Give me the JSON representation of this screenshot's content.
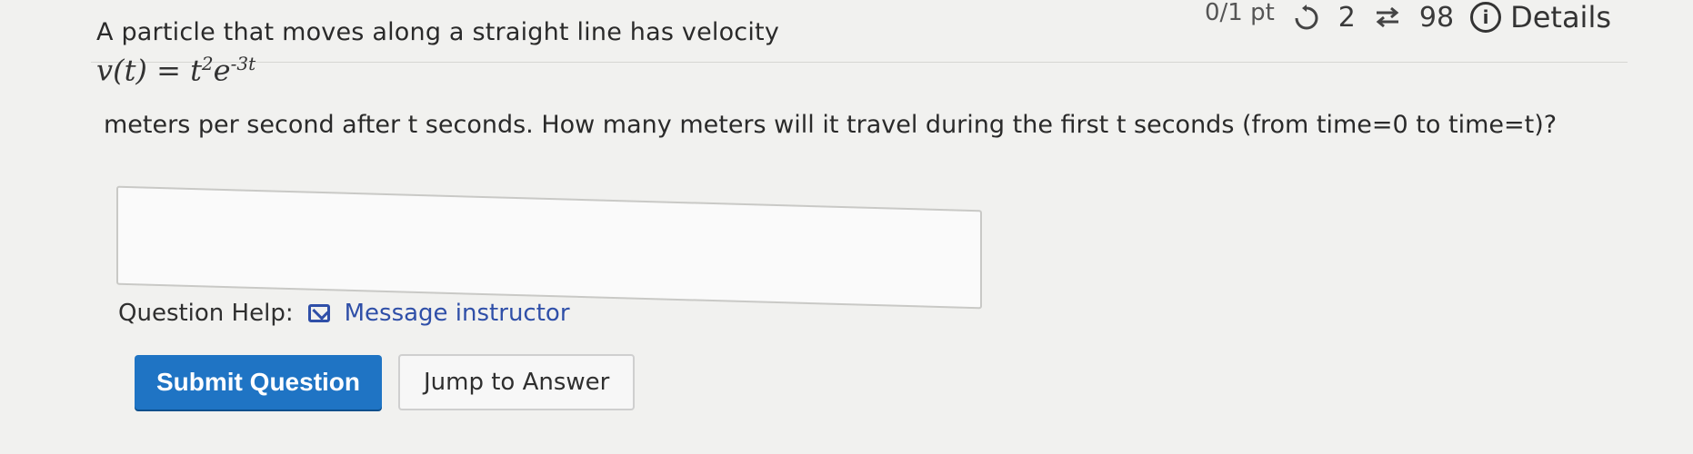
{
  "top_meta": {
    "points": "0/1 pt",
    "attempts": "2",
    "submissions": "98",
    "details_label": "Details"
  },
  "question": {
    "intro": "A particle that moves along a straight line has velocity",
    "formula": {
      "lhs": "v(t) =",
      "base": "t",
      "exp1": "2",
      "e": "e",
      "exp2": "-3t"
    },
    "continuation": "meters per second after t seconds. How many meters will it travel during the first t seconds (from time=0 to time=t)?"
  },
  "answer_box": {
    "value": ""
  },
  "help": {
    "label": "Question Help:",
    "link": "Message instructor"
  },
  "actions": {
    "submit": "Submit Question",
    "jump": "Jump to Answer"
  }
}
